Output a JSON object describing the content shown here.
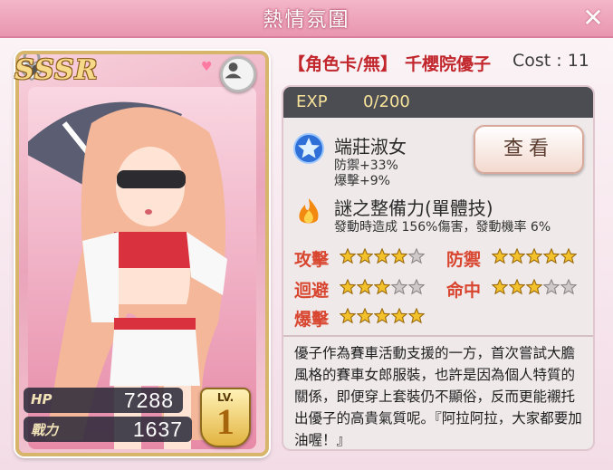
{
  "window": {
    "title": "熱情氛圍",
    "close_label": "✕"
  },
  "card": {
    "rarity": "SSSR",
    "hp_label": "HP",
    "hp_value": "7288",
    "power_label": "戰力",
    "power_value": "1637",
    "level_label": "LV.",
    "level_value": "1"
  },
  "header": {
    "type_tag": "【角色卡/無】",
    "character_name": "千櫻院優子",
    "cost_label": "Cost : 11"
  },
  "exp": {
    "label": "EXP",
    "value": "0/200"
  },
  "skill1": {
    "icon": "blue-star-badge-icon",
    "name": "端莊淑女",
    "desc_line1": "防禦+33%",
    "desc_line2": "爆擊+9%"
  },
  "view_button": {
    "label": "查看"
  },
  "skill2": {
    "icon": "flame-icon",
    "name": "謎之整備力(單體技)",
    "desc": "發動時造成 156%傷害，發動機率 6%"
  },
  "ratings": [
    {
      "label": "攻擊",
      "stars": 4,
      "max": 5
    },
    {
      "label": "防禦",
      "stars": 5,
      "max": 5
    },
    {
      "label": "迴避",
      "stars": 3,
      "max": 5
    },
    {
      "label": "命中",
      "stars": 3,
      "max": 5
    },
    {
      "label": "爆擊",
      "stars": 5,
      "max": 5
    }
  ],
  "description": "優子作為賽車活動支援的一方，首次嘗試大膽風格的賽車女郎服裝，也許是因為個人特質的關係，即便穿上套裝仍不顯俗，反而更能襯托出優子的高貴氣質呢。『阿拉阿拉，大家都要加油喔！』",
  "colors": {
    "accent_pink": "#e996b0",
    "rating_red": "#d8462f",
    "star_gold": "#f3c12c",
    "name_red": "#c2272d"
  }
}
